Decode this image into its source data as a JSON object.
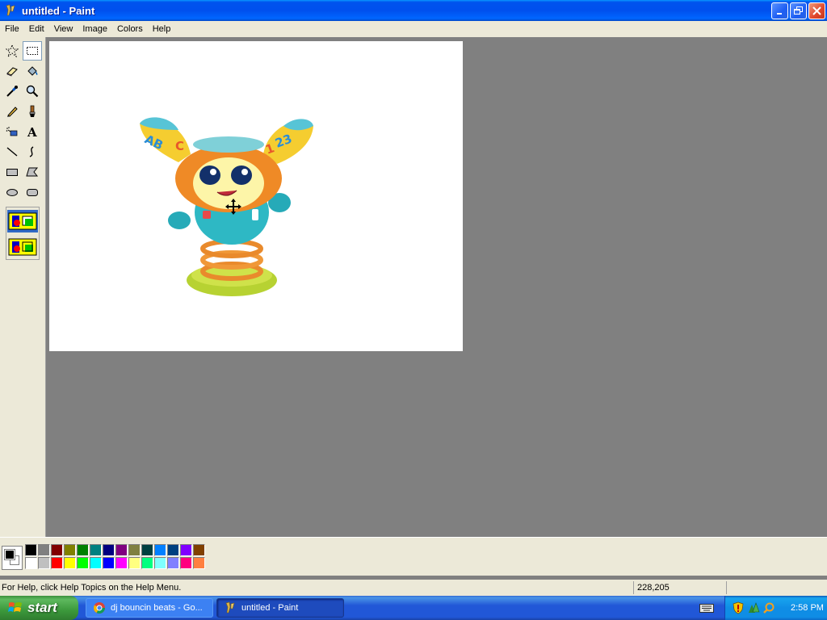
{
  "window": {
    "title": "untitled - Paint",
    "app_icon": "paint-icon",
    "controls": [
      "minimize-icon",
      "restore-icon",
      "close-icon"
    ]
  },
  "menubar": {
    "items": [
      {
        "label": "File"
      },
      {
        "label": "Edit"
      },
      {
        "label": "View"
      },
      {
        "label": "Image"
      },
      {
        "label": "Colors"
      },
      {
        "label": "Help"
      }
    ]
  },
  "toolbox": {
    "tools": [
      {
        "name": "free-form-select",
        "icon": "free-form-select-icon"
      },
      {
        "name": "select",
        "icon": "rect-select-icon",
        "active": true
      },
      {
        "name": "eraser",
        "icon": "eraser-icon"
      },
      {
        "name": "fill-with-color",
        "icon": "paint-bucket-icon"
      },
      {
        "name": "pick-color",
        "icon": "eyedropper-icon"
      },
      {
        "name": "magnifier",
        "icon": "magnifier-icon"
      },
      {
        "name": "pencil",
        "icon": "pencil-icon"
      },
      {
        "name": "brush",
        "icon": "brush-icon"
      },
      {
        "name": "airbrush",
        "icon": "airbrush-icon"
      },
      {
        "name": "text",
        "icon": "text-icon"
      },
      {
        "name": "line",
        "icon": "line-icon"
      },
      {
        "name": "curve",
        "icon": "curve-icon"
      },
      {
        "name": "rectangle",
        "icon": "rectangle-icon"
      },
      {
        "name": "polygon",
        "icon": "polygon-icon"
      },
      {
        "name": "ellipse",
        "icon": "ellipse-icon"
      },
      {
        "name": "rounded-rectangle",
        "icon": "rounded-rectangle-icon"
      }
    ],
    "options": [
      {
        "name": "opaque-selection",
        "icon": "opaque-selection-icon",
        "selected": true
      },
      {
        "name": "transparent-selection",
        "icon": "transparent-selection-icon",
        "selected": false
      }
    ]
  },
  "canvas": {
    "image_subject": "dancing-robot-toy-image",
    "cursor": "move-cursor-icon"
  },
  "colorbox": {
    "foreground": "#000000",
    "background": "#ffffff",
    "palette_row1": [
      "#000000",
      "#808080",
      "#800000",
      "#808000",
      "#008000",
      "#008080",
      "#000080",
      "#800080",
      "#808040",
      "#004040",
      "#0080ff",
      "#004080",
      "#8000ff",
      "#804000"
    ],
    "palette_row2": [
      "#ffffff",
      "#c0c0c0",
      "#ff0000",
      "#ffff00",
      "#00ff00",
      "#00ffff",
      "#0000ff",
      "#ff00ff",
      "#ffff80",
      "#00ff80",
      "#80ffff",
      "#8080ff",
      "#ff0080",
      "#ff8040"
    ]
  },
  "statusbar": {
    "help_text": "For Help, click Help Topics on the Help Menu.",
    "coordinates": "228,205",
    "size": ""
  },
  "taskbar": {
    "start_label": "start",
    "tasks": [
      {
        "label": "dj bouncin beats - Go...",
        "icon": "chrome-icon",
        "active": false
      },
      {
        "label": "untitled - Paint",
        "icon": "paint-icon",
        "active": true
      }
    ],
    "tray_icons": [
      "keyboard-icon",
      "security-shield-icon",
      "network-icon",
      "search-icon"
    ],
    "clock": "2:58 PM"
  }
}
